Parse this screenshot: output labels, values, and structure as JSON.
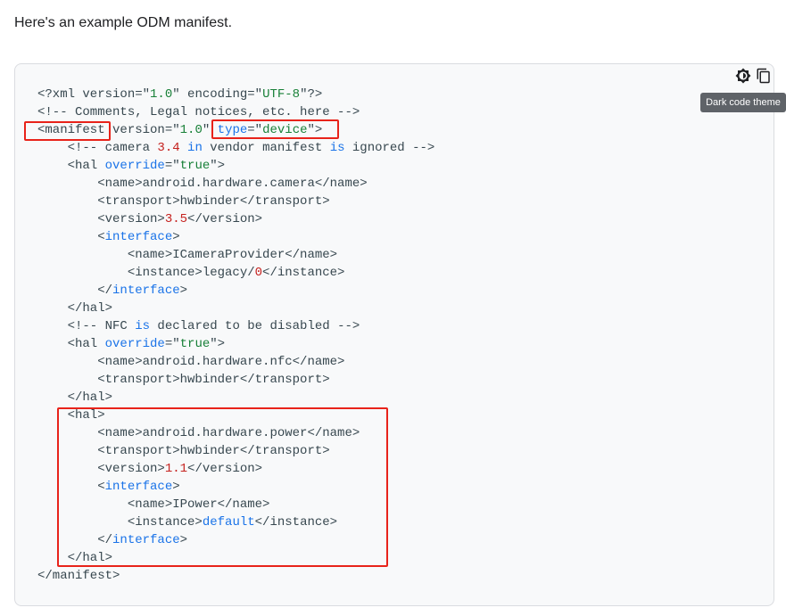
{
  "intro": {
    "text": "Here's an example ODM manifest."
  },
  "toolbar": {
    "theme_icon": "dark-theme-icon",
    "copy_icon": "copy-icon",
    "tooltip": "Dark code theme"
  },
  "code_lines": [
    [
      {
        "t": "<?xml version=\"",
        "c": ""
      },
      {
        "t": "1.0",
        "c": "s"
      },
      {
        "t": "\" encoding=\"",
        "c": ""
      },
      {
        "t": "UTF-8",
        "c": "s"
      },
      {
        "t": "\"?>",
        "c": ""
      }
    ],
    [
      {
        "t": "<!-- Comments, Legal notices, etc. here -->",
        "c": ""
      }
    ],
    [
      {
        "t": "<manifest version=\"",
        "c": ""
      },
      {
        "t": "1.0",
        "c": "s"
      },
      {
        "t": "\" ",
        "c": ""
      },
      {
        "t": "type",
        "c": "k"
      },
      {
        "t": "=\"",
        "c": ""
      },
      {
        "t": "device",
        "c": "s"
      },
      {
        "t": "\">",
        "c": ""
      }
    ],
    [
      {
        "t": "    <!-- camera ",
        "c": ""
      },
      {
        "t": "3.4",
        "c": "n"
      },
      {
        "t": " ",
        "c": ""
      },
      {
        "t": "in",
        "c": "k"
      },
      {
        "t": " vendor manifest ",
        "c": ""
      },
      {
        "t": "is",
        "c": "k"
      },
      {
        "t": " ignored -->",
        "c": ""
      }
    ],
    [
      {
        "t": "    <hal ",
        "c": ""
      },
      {
        "t": "override",
        "c": "k"
      },
      {
        "t": "=\"",
        "c": ""
      },
      {
        "t": "true",
        "c": "s"
      },
      {
        "t": "\">",
        "c": ""
      }
    ],
    [
      {
        "t": "        <name>android.hardware.camera</name>",
        "c": ""
      }
    ],
    [
      {
        "t": "        <transport>hwbinder</transport>",
        "c": ""
      }
    ],
    [
      {
        "t": "        <version>",
        "c": ""
      },
      {
        "t": "3.5",
        "c": "n"
      },
      {
        "t": "</version>",
        "c": ""
      }
    ],
    [
      {
        "t": "        <",
        "c": ""
      },
      {
        "t": "interface",
        "c": "k"
      },
      {
        "t": ">",
        "c": ""
      }
    ],
    [
      {
        "t": "            <name>ICameraProvider</name>",
        "c": ""
      }
    ],
    [
      {
        "t": "            <instance>legacy/",
        "c": ""
      },
      {
        "t": "0",
        "c": "n"
      },
      {
        "t": "</instance>",
        "c": ""
      }
    ],
    [
      {
        "t": "        </",
        "c": ""
      },
      {
        "t": "interface",
        "c": "k"
      },
      {
        "t": ">",
        "c": ""
      }
    ],
    [
      {
        "t": "    </hal>",
        "c": ""
      }
    ],
    [
      {
        "t": "    <!-- NFC ",
        "c": ""
      },
      {
        "t": "is",
        "c": "k"
      },
      {
        "t": " declared to be disabled -->",
        "c": ""
      }
    ],
    [
      {
        "t": "    <hal ",
        "c": ""
      },
      {
        "t": "override",
        "c": "k"
      },
      {
        "t": "=\"",
        "c": ""
      },
      {
        "t": "true",
        "c": "s"
      },
      {
        "t": "\">",
        "c": ""
      }
    ],
    [
      {
        "t": "        <name>android.hardware.nfc</name>",
        "c": ""
      }
    ],
    [
      {
        "t": "        <transport>hwbinder</transport>",
        "c": ""
      }
    ],
    [
      {
        "t": "    </hal>",
        "c": ""
      }
    ],
    [
      {
        "t": "    <hal>",
        "c": ""
      }
    ],
    [
      {
        "t": "        <name>android.hardware.power</name>",
        "c": ""
      }
    ],
    [
      {
        "t": "        <transport>hwbinder</transport>",
        "c": ""
      }
    ],
    [
      {
        "t": "        <version>",
        "c": ""
      },
      {
        "t": "1.1",
        "c": "n"
      },
      {
        "t": "</version>",
        "c": ""
      }
    ],
    [
      {
        "t": "        <",
        "c": ""
      },
      {
        "t": "interface",
        "c": "k"
      },
      {
        "t": ">",
        "c": ""
      }
    ],
    [
      {
        "t": "            <name>IPower</name>",
        "c": ""
      }
    ],
    [
      {
        "t": "            <instance>",
        "c": ""
      },
      {
        "t": "default",
        "c": "k"
      },
      {
        "t": "</instance>",
        "c": ""
      }
    ],
    [
      {
        "t": "        </",
        "c": ""
      },
      {
        "t": "interface",
        "c": "k"
      },
      {
        "t": ">",
        "c": ""
      }
    ],
    [
      {
        "t": "    </hal>",
        "c": ""
      }
    ],
    [
      {
        "t": "</manifest>",
        "c": ""
      }
    ]
  ],
  "colors": {
    "number": "#c5221f",
    "string": "#188038",
    "keyword": "#1a73e8",
    "text": "#37474f",
    "highlight_border": "#e8231a",
    "code_background": "#f8f9fa"
  }
}
